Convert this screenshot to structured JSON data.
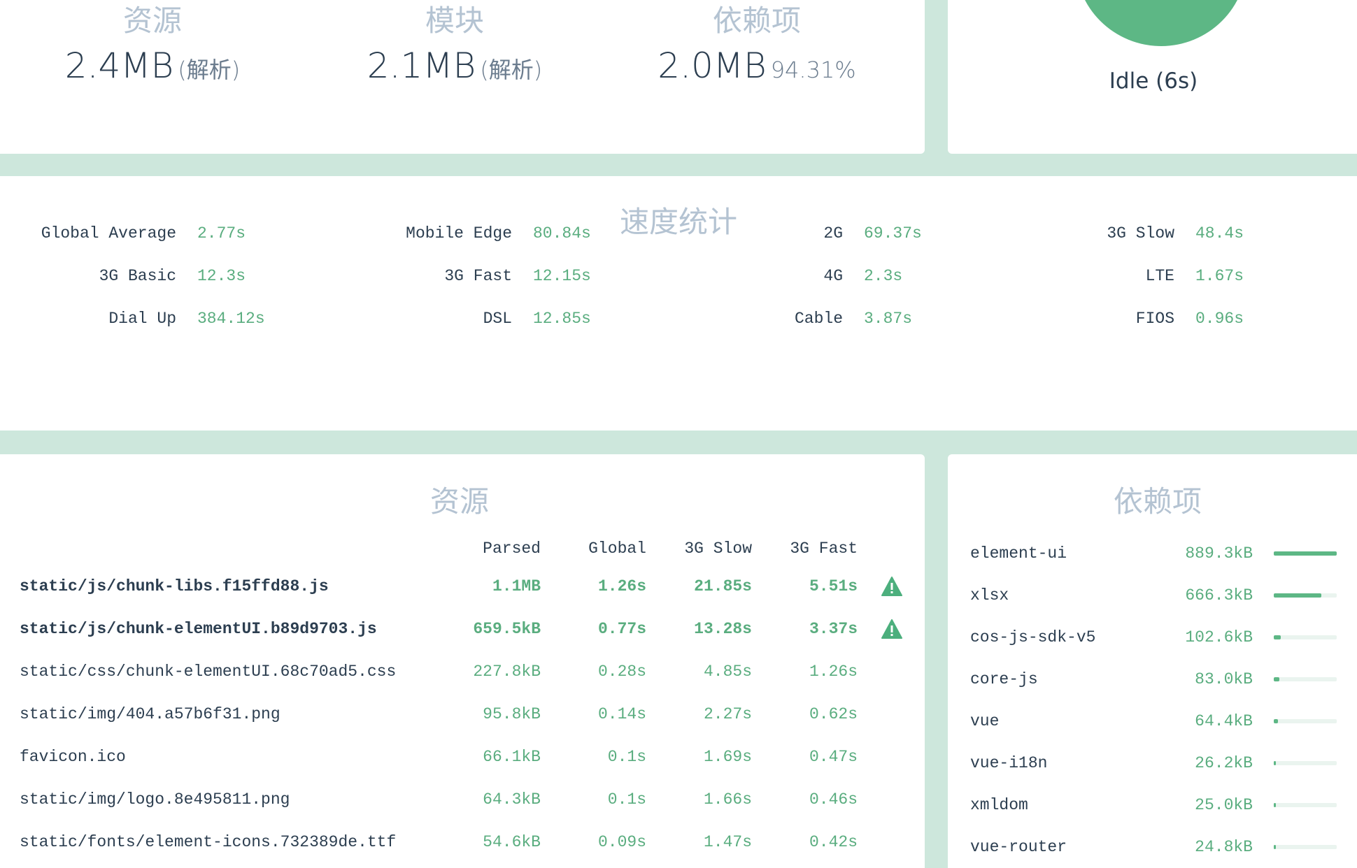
{
  "summary": {
    "assets": {
      "title": "资源",
      "value": "2.4MB",
      "note": "(解析)"
    },
    "modules": {
      "title": "模块",
      "value": "2.1MB",
      "note": "(解析)"
    },
    "dependencies": {
      "title": "依赖项",
      "value": "2.0MB",
      "note": "94.31%"
    }
  },
  "status": {
    "text": "Idle (6s)",
    "color": "#5db785"
  },
  "speed": {
    "title": "速度统计",
    "items": [
      {
        "name": "Global Average",
        "value": "2.77s"
      },
      {
        "name": "Mobile Edge",
        "value": "80.84s"
      },
      {
        "name": "2G",
        "value": "69.37s"
      },
      {
        "name": "3G Slow",
        "value": "48.4s"
      },
      {
        "name": "3G Basic",
        "value": "12.3s"
      },
      {
        "name": "3G Fast",
        "value": "12.15s"
      },
      {
        "name": "4G",
        "value": "2.3s"
      },
      {
        "name": "LTE",
        "value": "1.67s"
      },
      {
        "name": "Dial Up",
        "value": "384.12s"
      },
      {
        "name": "DSL",
        "value": "12.85s"
      },
      {
        "name": "Cable",
        "value": "3.87s"
      },
      {
        "name": "FIOS",
        "value": "0.96s"
      }
    ]
  },
  "assets": {
    "title": "资源",
    "columns": [
      "Parsed",
      "Global",
      "3G Slow",
      "3G Fast"
    ],
    "rows": [
      {
        "name": "static/js/chunk-libs.f15ffd88.js",
        "parsed": "1.1MB",
        "global": "1.26s",
        "slow3g": "21.85s",
        "fast3g": "5.51s",
        "warning": true
      },
      {
        "name": "static/js/chunk-elementUI.b89d9703.js",
        "parsed": "659.5kB",
        "global": "0.77s",
        "slow3g": "13.28s",
        "fast3g": "3.37s",
        "warning": true
      },
      {
        "name": "static/css/chunk-elementUI.68c70ad5.css",
        "parsed": "227.8kB",
        "global": "0.28s",
        "slow3g": "4.85s",
        "fast3g": "1.26s",
        "warning": false
      },
      {
        "name": "static/img/404.a57b6f31.png",
        "parsed": "95.8kB",
        "global": "0.14s",
        "slow3g": "2.27s",
        "fast3g": "0.62s",
        "warning": false
      },
      {
        "name": "favicon.ico",
        "parsed": "66.1kB",
        "global": "0.1s",
        "slow3g": "1.69s",
        "fast3g": "0.47s",
        "warning": false
      },
      {
        "name": "static/img/logo.8e495811.png",
        "parsed": "64.3kB",
        "global": "0.1s",
        "slow3g": "1.66s",
        "fast3g": "0.46s",
        "warning": false
      },
      {
        "name": "static/fonts/element-icons.732389de.ttf",
        "parsed": "54.6kB",
        "global": "0.09s",
        "slow3g": "1.47s",
        "fast3g": "0.42s",
        "warning": false
      }
    ]
  },
  "dependencies": {
    "title": "依赖项",
    "items": [
      {
        "name": "element-ui",
        "size": "889.3kB",
        "fraction": 1.0
      },
      {
        "name": "xlsx",
        "size": "666.3kB",
        "fraction": 0.75
      },
      {
        "name": "cos-js-sdk-v5",
        "size": "102.6kB",
        "fraction": 0.115
      },
      {
        "name": "core-js",
        "size": "83.0kB",
        "fraction": 0.093
      },
      {
        "name": "vue",
        "size": "64.4kB",
        "fraction": 0.072
      },
      {
        "name": "vue-i18n",
        "size": "26.2kB",
        "fraction": 0.029
      },
      {
        "name": "xmldom",
        "size": "25.0kB",
        "fraction": 0.028
      },
      {
        "name": "vue-router",
        "size": "24.8kB",
        "fraction": 0.028
      }
    ]
  },
  "icons": {
    "warning": "warning-triangle-icon"
  }
}
